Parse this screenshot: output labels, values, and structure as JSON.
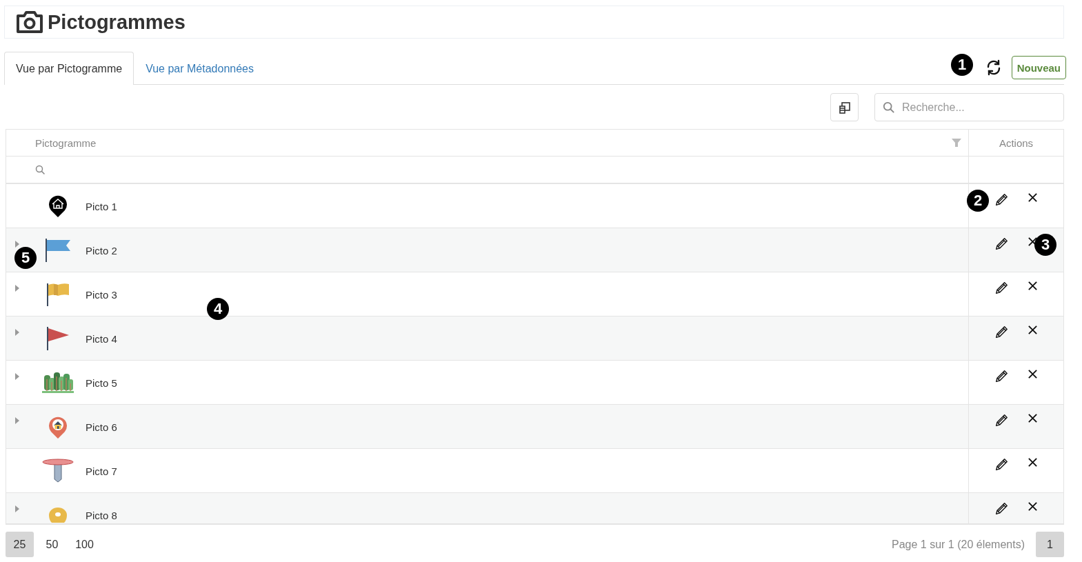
{
  "page": {
    "title": "Pictogrammes"
  },
  "tabs": [
    {
      "label": "Vue par Pictogramme",
      "selected": true
    },
    {
      "label": "Vue par Métadonnées",
      "selected": false
    }
  ],
  "new_button": "Nouveau",
  "search": {
    "placeholder": "Recherche..."
  },
  "table": {
    "columns": [
      "Pictogramme",
      "Actions"
    ],
    "rows": [
      {
        "name": "Picto 1",
        "kind": "homepin",
        "expandable": false
      },
      {
        "name": "Picto 2",
        "kind": "flag",
        "expandable": true
      },
      {
        "name": "Picto 3",
        "kind": "banner",
        "expandable": true
      },
      {
        "name": "Picto 4",
        "kind": "pennant",
        "expandable": true
      },
      {
        "name": "Picto 5",
        "kind": "forest",
        "expandable": true
      },
      {
        "name": "Picto 6",
        "kind": "housepin",
        "expandable": true
      },
      {
        "name": "Picto 7",
        "kind": "thumbtack",
        "expandable": false
      },
      {
        "name": "Picto 8",
        "kind": "pin",
        "expandable": true
      }
    ]
  },
  "pagination": {
    "sizes": [
      {
        "label": "25",
        "selected": true
      },
      {
        "label": "50",
        "selected": false
      },
      {
        "label": "100",
        "selected": false
      }
    ],
    "summary": "Page 1 sur 1 (20 élements)",
    "pages": [
      {
        "label": "1",
        "selected": true
      }
    ]
  },
  "callouts": [
    "1",
    "2",
    "3",
    "4",
    "5"
  ]
}
